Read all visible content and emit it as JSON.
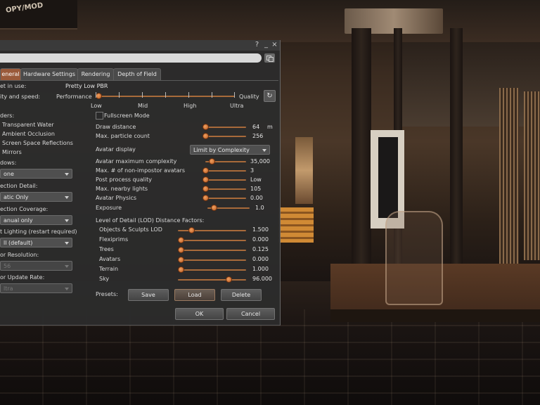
{
  "scene": {
    "sign_text": "OPY/MOD"
  },
  "window": {
    "help_btn": "?",
    "minimize_btn": "_",
    "close_btn": "×"
  },
  "tabs": [
    {
      "label": "eneral",
      "active": true
    },
    {
      "label": "Hardware Settings",
      "active": false
    },
    {
      "label": "Rendering",
      "active": false
    },
    {
      "label": "Depth of Field",
      "active": false
    }
  ],
  "general": {
    "preset_label": "et in use:",
    "preset_value": "Pretty Low PBR",
    "quality_label": "ity and speed:",
    "quality_left": "Performance",
    "quality_right": "Quality",
    "quality_level": 0.0,
    "ticks": [
      "Low",
      "Mid",
      "High",
      "Ultra"
    ],
    "fullscreen_label": "Fullscreen Mode",
    "shaders_label": "ders:",
    "shader_options": [
      "Transparent Water",
      "Ambient Occlusion",
      "Screen Space Reflections",
      "Mirrors"
    ],
    "shadows_label": "dows:",
    "shadows_value": "one",
    "reflection_detail_label": "ection Detail:",
    "reflection_detail_value": "atic Only",
    "reflection_coverage_label": "ection Coverage:",
    "reflection_coverage_value": "anual only",
    "lighting_label": "t Lighting (restart required)",
    "lighting_value": "ll (default)",
    "mirror_res_label": "or Resolution:",
    "mirror_res_value": "56",
    "mirror_rate_label": "or Update Rate:",
    "mirror_rate_value": "ltra"
  },
  "settings": {
    "draw_distance": {
      "label": "Draw distance",
      "value": "64",
      "unit": "m",
      "level": 0.0
    },
    "particles": {
      "label": "Max. particle count",
      "value": "256",
      "level": 0.0
    },
    "avatar_display_label": "Avatar display",
    "avatar_display_value": "Limit by Complexity",
    "avatar_complexity": {
      "label": "Avatar maximum complexity",
      "value": "35,000",
      "level": 0.08
    },
    "non_impostor": {
      "label": "Max. # of non-impostor avatars",
      "value": "3",
      "level": 0.0
    },
    "post_process": {
      "label": "Post process quality",
      "value": "Low",
      "level": 0.0
    },
    "nearby_lights": {
      "label": "Max. nearby lights",
      "value": "105",
      "level": 0.0
    },
    "avatar_physics": {
      "label": "Avatar Physics",
      "value": "0.00",
      "level": 0.0
    },
    "exposure": {
      "label": "Exposure",
      "value": "1.0",
      "level": 0.08
    },
    "lod_heading": "Level of Detail (LOD) Distance Factors:",
    "lod": [
      {
        "label": "Objects & Sculpts LOD",
        "value": "1.500",
        "level": 0.15
      },
      {
        "label": "Flexiprims",
        "value": "0.000",
        "level": 0.0
      },
      {
        "label": "Trees",
        "value": "0.125",
        "level": 0.0
      },
      {
        "label": "Avatars",
        "value": "0.000",
        "level": 0.0
      },
      {
        "label": "Terrain",
        "value": "1.000",
        "level": 0.0
      },
      {
        "label": "Sky",
        "value": "96.000",
        "level": 0.7
      }
    ],
    "presets_label": "Presets:",
    "save": "Save",
    "load": "Load",
    "delete": "Delete"
  },
  "footer": {
    "ok": "OK",
    "cancel": "Cancel"
  },
  "colors": {
    "accent": "#9a5a3a",
    "slider": "#d07030",
    "panel_bg": "#2c2c2c"
  }
}
